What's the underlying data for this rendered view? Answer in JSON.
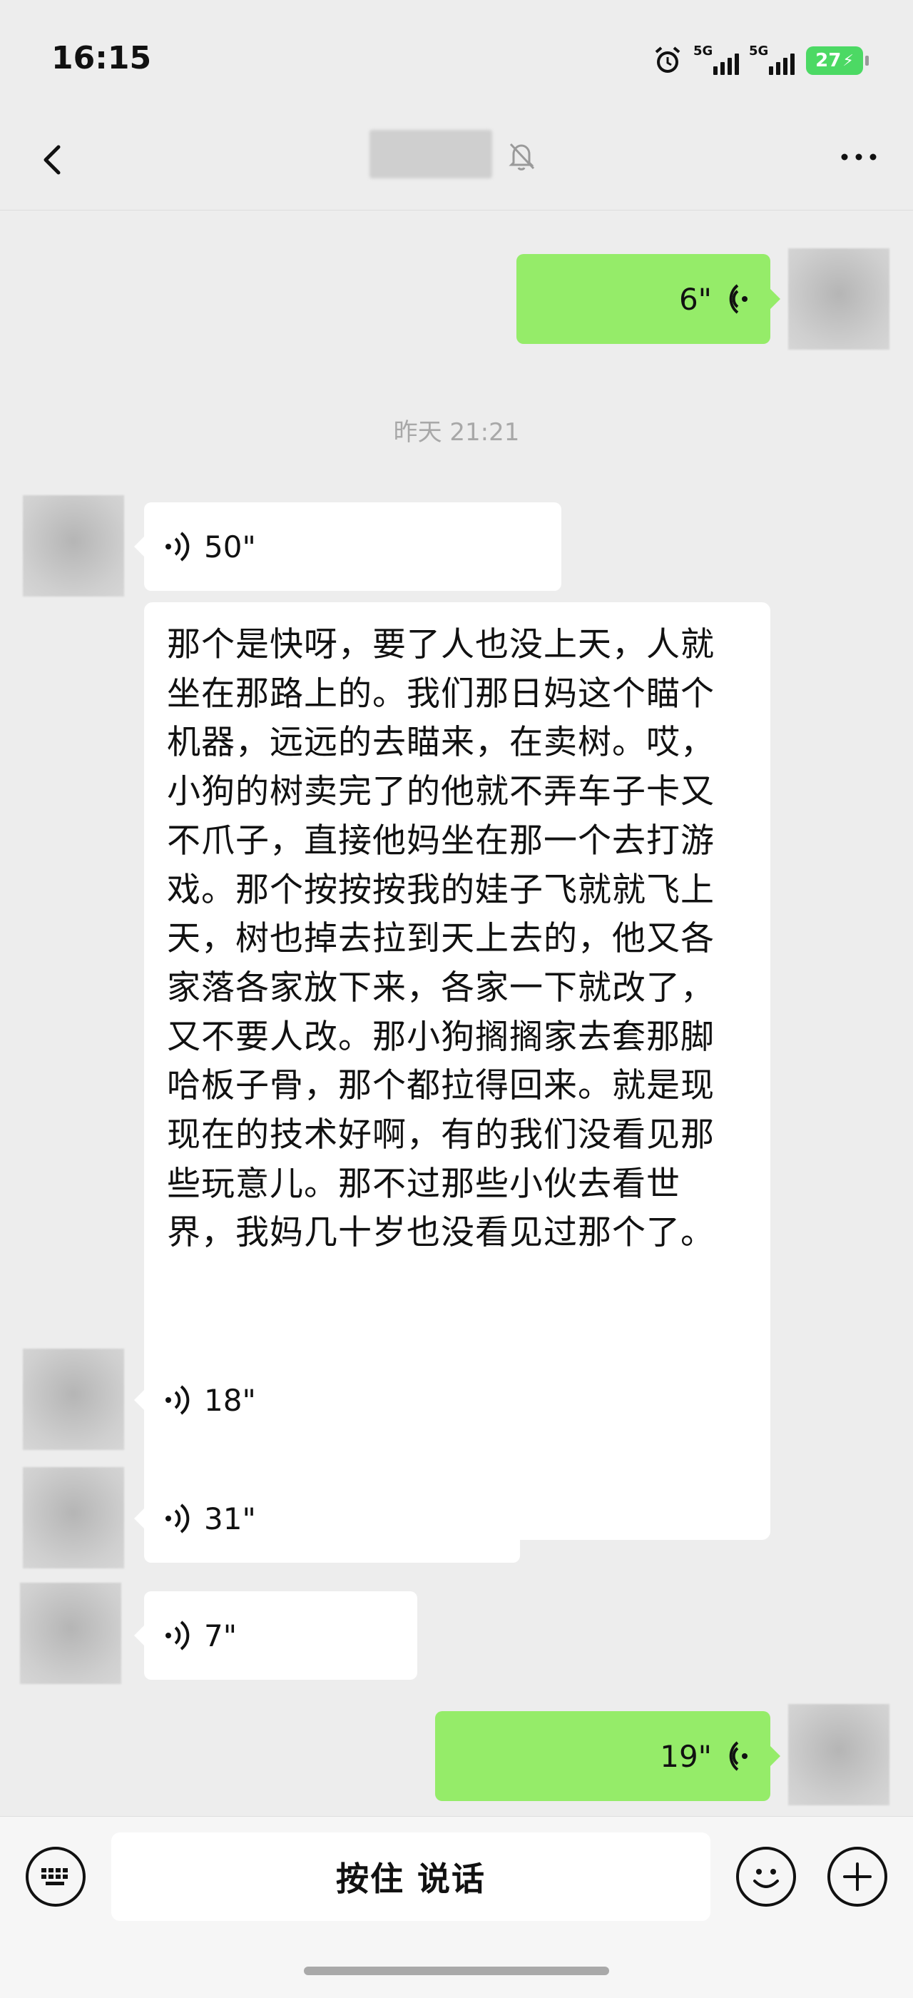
{
  "status_bar": {
    "time": "16:15",
    "network_1": "5G",
    "network_2": "5G",
    "battery": "27",
    "battery_color": "#4cd964"
  },
  "nav": {
    "back_icon": "chevron-left-icon",
    "mute_icon": "bell-off-icon",
    "more_icon": "more-dots-icon"
  },
  "messages": {
    "out_voice_1": {
      "duration": "6\""
    },
    "timestamp": "昨天 21:21",
    "in_voice_1": {
      "duration": "50\""
    },
    "transcript": "那个是快呀，要了人也没上天，人就坐在那路上的。我们那日妈这个瞄个机器，远远的去瞄来，在卖树。哎，小狗的树卖完了的他就不弄车子卡又不爪子，直接他妈坐在那一个去打游戏。那个按按按我的娃子飞就就飞上天，树也掉去拉到天上去的，他又各家落各家放下来，各家一下就改了，又不要人改。那小狗搁搁家去套那脚哈板子骨，那个都拉得回来。就是现现在的技术好啊，有的我们没看见那些玩意儿。那不过那些小伙去看世界，我妈几十岁也没看见过那个了。",
    "in_voice_2": {
      "duration": "18\""
    },
    "in_voice_3": {
      "duration": "31\""
    },
    "in_voice_4": {
      "duration": "7\""
    },
    "out_voice_2": {
      "duration": "19\""
    }
  },
  "input_bar": {
    "keyboard_icon": "keyboard-icon",
    "hold_to_talk_label": "按住 说话",
    "emoji_icon": "emoji-icon",
    "plus_icon": "plus-icon"
  },
  "colors": {
    "bubble_out": "#95ec69",
    "bubble_in": "#ffffff",
    "background": "#ededed"
  }
}
